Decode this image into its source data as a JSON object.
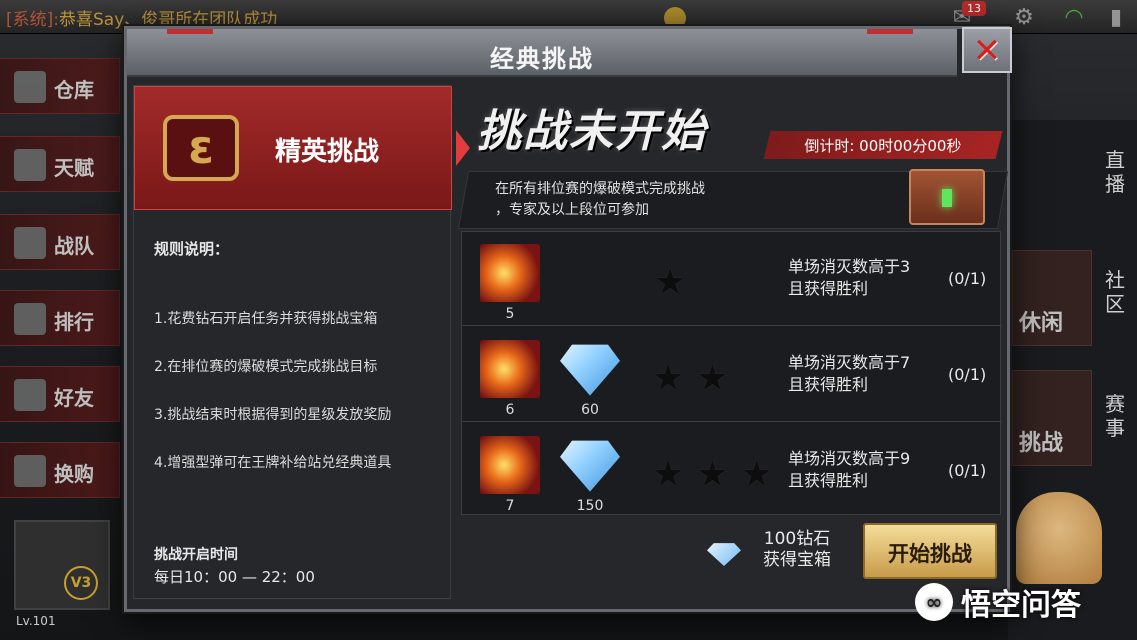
{
  "background": {
    "system_tag": "[系统]:",
    "system_message": "恭喜Say、俊哥所在团队成功",
    "mail_badge": "13",
    "nav": [
      "仓库",
      "天赋",
      "战队",
      "排行",
      "好友",
      "换购"
    ],
    "right_tabs": [
      "直播",
      "社区",
      "赛事"
    ],
    "right_cards": [
      "休闲",
      "挑战"
    ],
    "vip": "V3",
    "level": "Lv.101"
  },
  "modal": {
    "title": "经典挑战",
    "close_label": "✕",
    "elite_label": "精英挑战",
    "status_banner": "挑战未开始",
    "countdown": "倒计时: 00时00分00秒",
    "desc": [
      "在所有排位赛的爆破模式完成挑战",
      "，专家及以上段位可参加"
    ],
    "rules_title": "规则说明：",
    "rules": [
      "1.花费钻石开启任务并获得挑战宝箱",
      "2.在排位赛的爆破模式完成挑战目标",
      "3.挑战结束时根据得到的星级发放奖励",
      "4.增强型弹可在王牌补给站兑经典道具"
    ],
    "open_title": "挑战开启时间",
    "open_time": "每日10：00 — 22：00",
    "challenges": [
      {
        "bullets": "5",
        "diamonds": null,
        "stars": "★",
        "condition": [
          "单场消灭数高于3",
          "且获得胜利"
        ],
        "progress": "(0/1)"
      },
      {
        "bullets": "6",
        "diamonds": "60",
        "stars": "★★",
        "condition": [
          "单场消灭数高于7",
          "且获得胜利"
        ],
        "progress": "(0/1)"
      },
      {
        "bullets": "7",
        "diamonds": "150",
        "stars": "★★★",
        "condition": [
          "单场消灭数高于9",
          "且获得胜利"
        ],
        "progress": "(0/1)"
      }
    ],
    "cost": [
      "100钻石",
      "获得宝箱"
    ],
    "start_label": "开始挑战"
  },
  "watermark": "悟空问答",
  "colors": {
    "accent_red": "#a32a2a",
    "gold": "#d4a94f",
    "button_gold": "#f4dd9a"
  }
}
